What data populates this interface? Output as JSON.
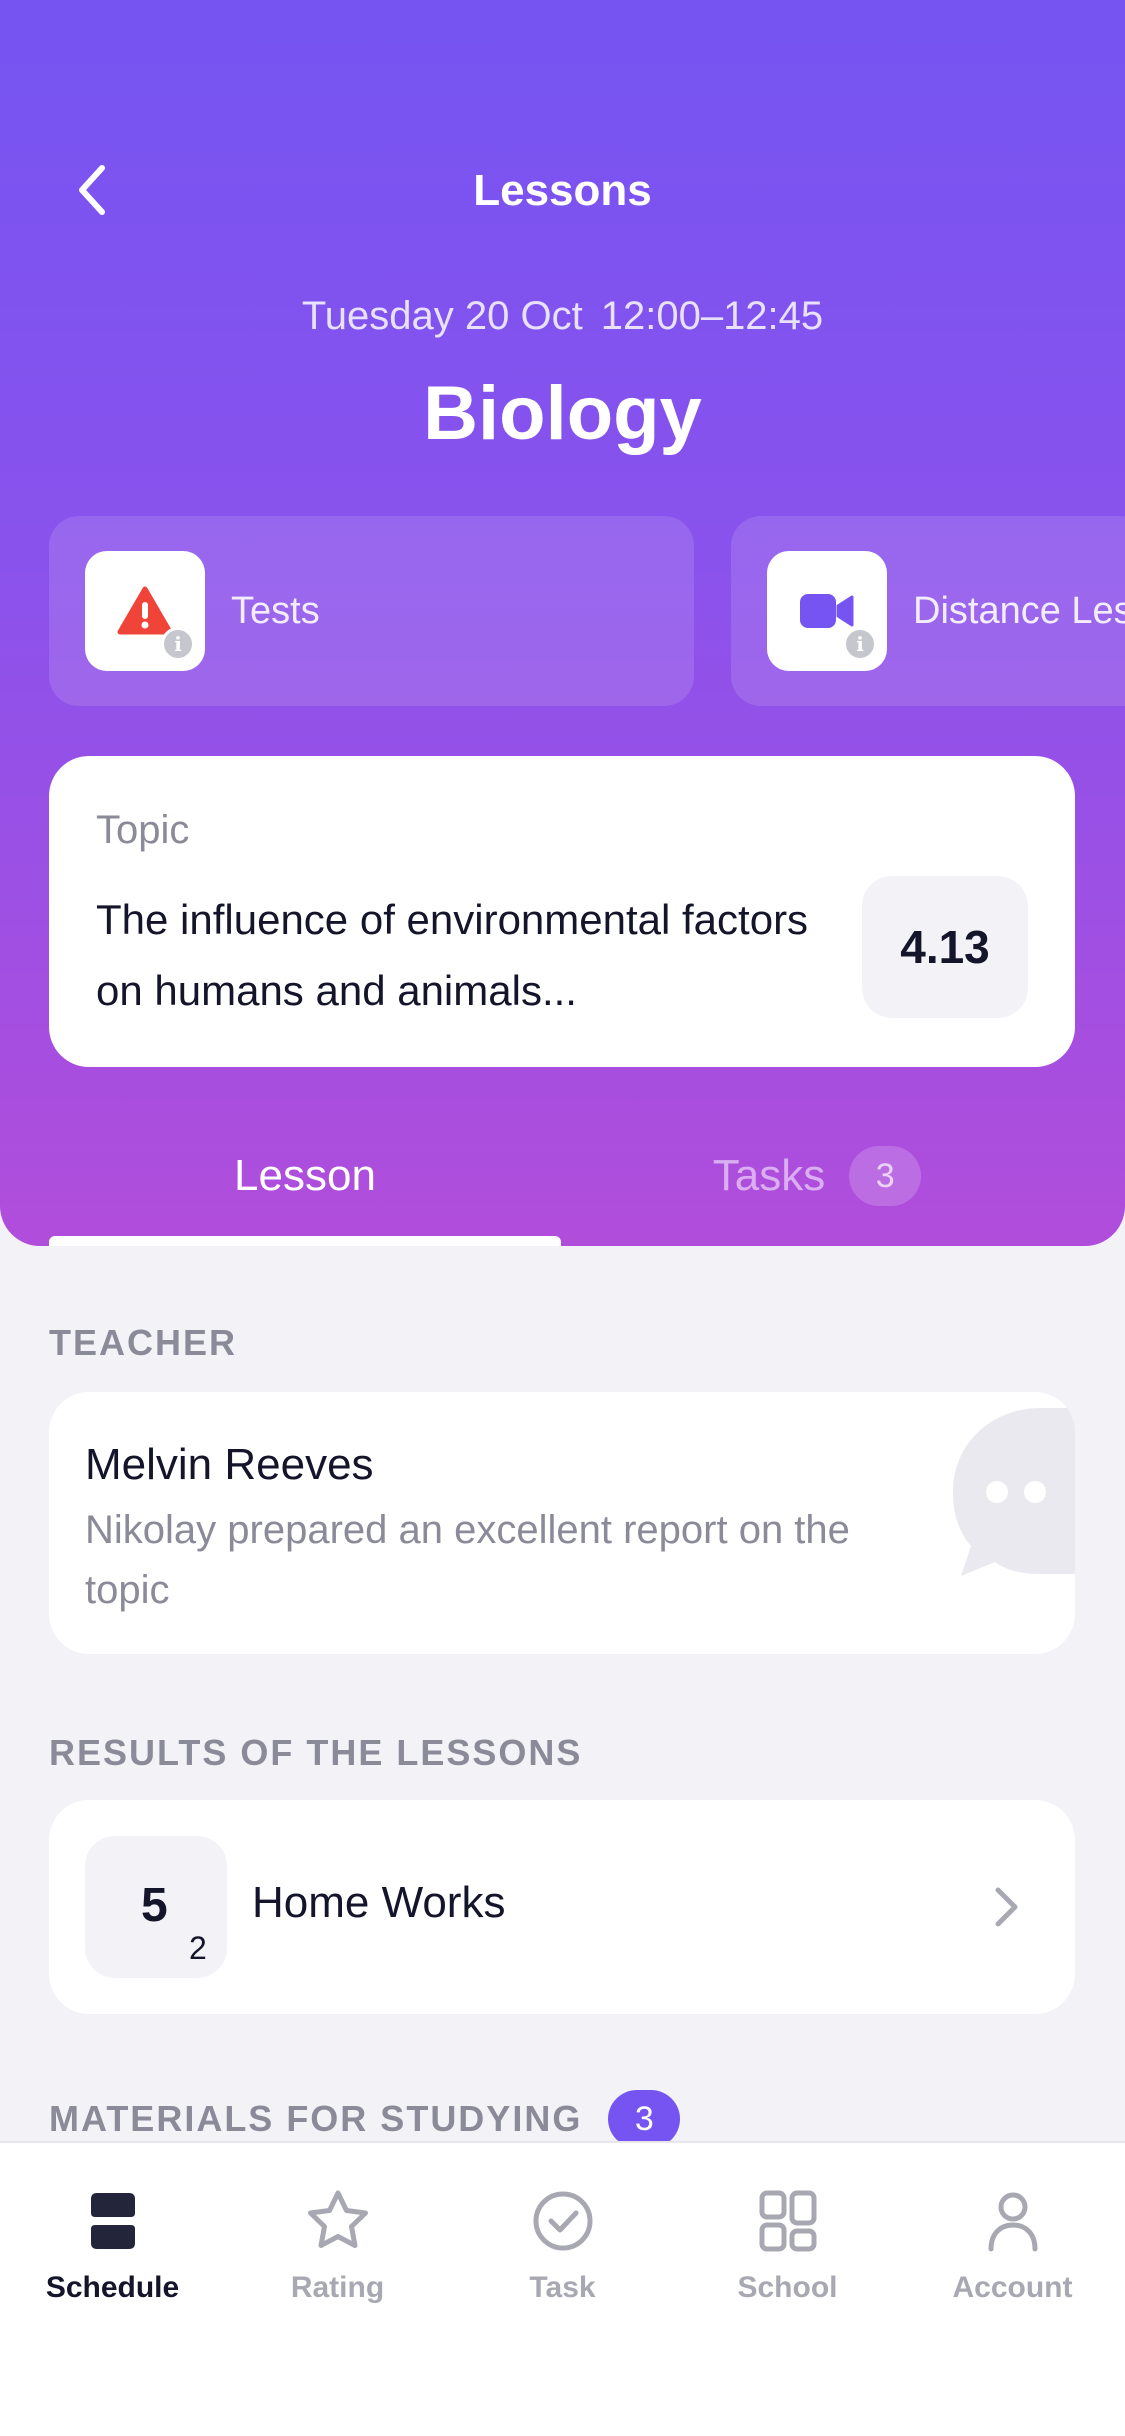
{
  "nav": {
    "title": "Lessons"
  },
  "lesson": {
    "date": "Tuesday 20 Oct",
    "time": "12:00–12:45",
    "subject": "Biology"
  },
  "chips": [
    {
      "label": "Tests",
      "icon": "warning-icon"
    },
    {
      "label": "Distance Lesson",
      "icon": "video-camera-icon"
    }
  ],
  "topic": {
    "label": "Topic",
    "text": "The influence of environmental factors on humans and animals...",
    "score": "4.13"
  },
  "tabs": {
    "lesson": "Lesson",
    "tasks": "Tasks",
    "tasks_count": "3"
  },
  "teacher": {
    "section": "TEACHER",
    "name": "Melvin Reeves",
    "comment": "Nikolay prepared an excellent report on the topic"
  },
  "results": {
    "section": "RESULTS OF THE LESSONS",
    "grade": "5",
    "grade_sub": "2",
    "title": "Home Works"
  },
  "materials": {
    "section": "MATERIALS FOR STUDYING",
    "count": "3"
  },
  "tabbar": {
    "schedule": "Schedule",
    "rating": "Rating",
    "task": "Task",
    "school": "School",
    "account": "Account"
  },
  "colors": {
    "accent": "#7554F2",
    "gradient_end": "#B14DDB",
    "warning": "#F04438",
    "background": "#F3F3F7"
  }
}
